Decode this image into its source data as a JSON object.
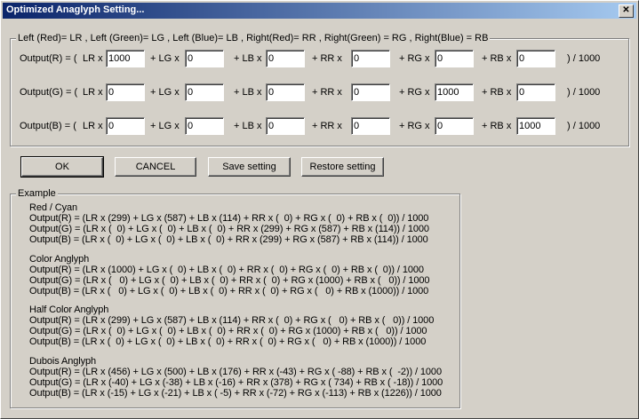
{
  "window": {
    "title": "Optimized Anaglyph Setting...",
    "close_glyph": "✕"
  },
  "matrix": {
    "legend": "Left (Red)= LR , Left (Green)= LG , Left (Blue)= LB , Right(Red)= RR , Right(Green) = RG , Right(Blue) = RB",
    "rows": [
      {
        "label": "Output(R) = (",
        "values": [
          "1000",
          "0",
          "0",
          "0",
          "0",
          "0"
        ]
      },
      {
        "label": "Output(G) = (",
        "values": [
          "0",
          "0",
          "0",
          "0",
          "1000",
          "0"
        ]
      },
      {
        "label": "Output(B) = (",
        "values": [
          "0",
          "0",
          "0",
          "0",
          "0",
          "1000"
        ]
      }
    ],
    "terms": [
      "LR x",
      "+ LG x",
      "+ LB x",
      "+ RR x",
      "+ RG x",
      "+ RB x"
    ],
    "suffix": ") / 1000"
  },
  "buttons": {
    "ok": "OK",
    "cancel": "CANCEL",
    "save": "Save setting",
    "restore": "Restore setting"
  },
  "example": {
    "legend": "Example",
    "sections": [
      {
        "title": "Red / Cyan",
        "lines": [
          "Output(R) = (LR x (299) + LG x (587) + LB x (114) + RR x (  0) + RG x (  0) + RB x (  0)) / 1000",
          "Output(G) = (LR x (  0) + LG x (  0) + LB x (  0) + RR x (299) + RG x (587) + RB x (114)) / 1000",
          "Output(B) = (LR x (  0) + LG x (  0) + LB x (  0) + RR x (299) + RG x (587) + RB x (114)) / 1000"
        ]
      },
      {
        "title": "Color Anglyph",
        "lines": [
          "Output(R) = (LR x (1000) + LG x (  0) + LB x (  0) + RR x (  0) + RG x (  0) + RB x (  0)) / 1000",
          "Output(G) = (LR x (   0) + LG x (  0) + LB x (  0) + RR x (  0) + RG x (1000) + RB x (   0)) / 1000",
          "Output(B) = (LR x (   0) + LG x (  0) + LB x (  0) + RR x (  0) + RG x (   0) + RB x (1000)) / 1000"
        ]
      },
      {
        "title": "Half Color Anglyph",
        "lines": [
          "Output(R) = (LR x (299) + LG x (587) + LB x (114) + RR x (  0) + RG x (   0) + RB x (   0)) / 1000",
          "Output(G) = (LR x (  0) + LG x (  0) + LB x (  0) + RR x (  0) + RG x (1000) + RB x (   0)) / 1000",
          "Output(B) = (LR x (  0) + LG x (  0) + LB x (  0) + RR x (  0) + RG x (   0) + RB x (1000)) / 1000"
        ]
      },
      {
        "title": "Dubois Anglyph",
        "lines": [
          "Output(R) = (LR x (456) + LG x (500) + LB x (176) + RR x (-43) + RG x ( -88) + RB x (  -2)) / 1000",
          "Output(G) = (LR x (-40) + LG x (-38) + LB x (-16) + RR x (378) + RG x ( 734) + RB x ( -18)) / 1000",
          "Output(B) = (LR x (-15) + LG x (-21) + LB x ( -5) + RR x (-72) + RG x (-113) + RB x (1226)) / 1000"
        ]
      }
    ]
  }
}
